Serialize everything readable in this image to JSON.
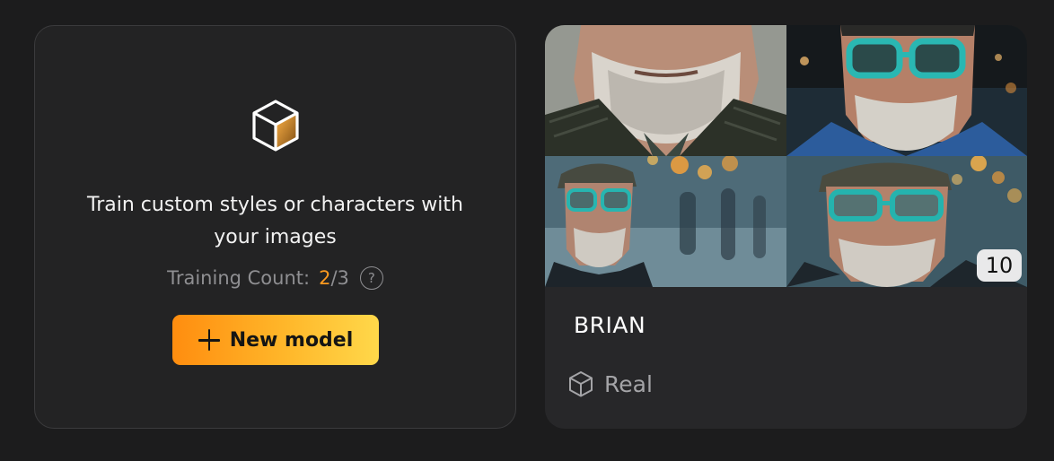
{
  "create_card": {
    "description": "Train custom styles or characters with your images",
    "training_label": "Training Count:",
    "training_used": "2",
    "training_total": "/3",
    "help_glyph": "?",
    "new_model_label": "New model",
    "icons": {
      "hero": "cube-icon",
      "help": "help-icon",
      "plus": "plus-icon"
    }
  },
  "model_card": {
    "name": "BRIAN",
    "type": "Real",
    "image_count": "10",
    "icons": {
      "type": "cube-outline-icon"
    }
  },
  "colors": {
    "background": "#1c1c1d",
    "card": "#232324",
    "accent_orange": "#ff9a1f",
    "button_gradient_start": "#ff8d0f",
    "button_gradient_end": "#ffd84a"
  }
}
